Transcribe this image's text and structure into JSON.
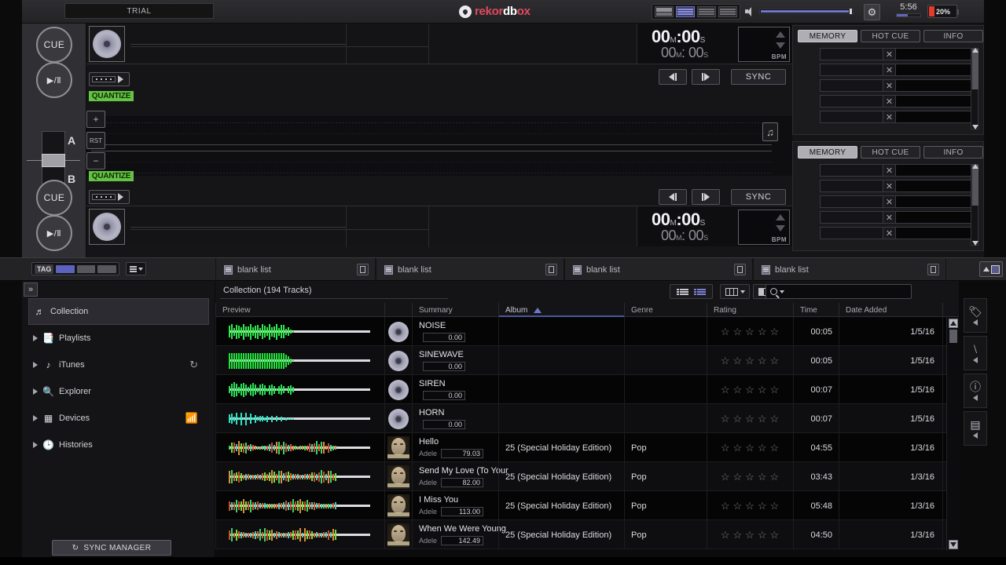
{
  "topbar": {
    "trial_label": "TRIAL",
    "logo": {
      "part1": "rek",
      "part2": "or",
      "part3": "db",
      "part4": "ox"
    },
    "clock_time": "5:56",
    "battery_pct": "20%",
    "gear_icon": "gear-icon",
    "speaker_icon": "speaker-icon"
  },
  "deck_controls": {
    "cue_label": "CUE",
    "play_pause_label": "▶/Ⅱ",
    "crossfader_a": "A",
    "crossfader_b": "B"
  },
  "decks": [
    {
      "id": "deck-a",
      "quantize_label": "QUANTIZE",
      "plus_label": "+",
      "reset_label": "RST",
      "minus_label": "−",
      "time_main_min": "00",
      "time_main_sec": "00",
      "time_sub_min": "00",
      "time_sub_sec": "00",
      "unit_m": "M",
      "unit_s": "S",
      "bpm_label": "BPM",
      "bpm_value": "",
      "sync_label": "SYNC"
    },
    {
      "id": "deck-b",
      "quantize_label": "QUANTIZE",
      "time_main_min": "00",
      "time_main_sec": "00",
      "time_sub_min": "00",
      "time_sub_sec": "00",
      "unit_m": "M",
      "unit_s": "S",
      "bpm_label": "BPM",
      "bpm_value": "",
      "sync_label": "SYNC"
    }
  ],
  "cue_panels": [
    {
      "tabs": [
        {
          "label": "MEMORY",
          "active": true
        },
        {
          "label": "HOT CUE",
          "active": false
        },
        {
          "label": "INFO",
          "active": false
        }
      ],
      "rows": [
        "",
        "",
        "",
        "",
        ""
      ],
      "delete_icon": "✕"
    },
    {
      "tabs": [
        {
          "label": "MEMORY",
          "active": true
        },
        {
          "label": "HOT CUE",
          "active": false
        },
        {
          "label": "INFO",
          "active": false
        }
      ],
      "rows": [
        "",
        "",
        "",
        "",
        ""
      ],
      "delete_icon": "✕"
    }
  ],
  "browser": {
    "tag_label": "TAG",
    "playlist_tabs": [
      {
        "label": "blank list"
      },
      {
        "label": "blank list"
      },
      {
        "label": "blank list"
      },
      {
        "label": "blank list"
      }
    ],
    "sidebar": {
      "items": [
        {
          "label": "Collection",
          "icon": "music-note-icon",
          "selected": true,
          "expandable": false,
          "trailing": ""
        },
        {
          "label": "Playlists",
          "icon": "playlist-icon",
          "selected": false,
          "expandable": true,
          "trailing": ""
        },
        {
          "label": "iTunes",
          "icon": "itunes-icon",
          "selected": false,
          "expandable": true,
          "trailing": "↻"
        },
        {
          "label": "Explorer",
          "icon": "explorer-icon",
          "selected": false,
          "expandable": true,
          "trailing": ""
        },
        {
          "label": "Devices",
          "icon": "usb-icon",
          "selected": false,
          "expandable": true,
          "trailing": "ᴴ"
        },
        {
          "label": "Histories",
          "icon": "history-icon",
          "selected": false,
          "expandable": true,
          "trailing": ""
        }
      ],
      "sync_manager_label": "SYNC MANAGER",
      "sync_icon": "refresh-icon"
    },
    "content_title": "Collection (194 Tracks)",
    "search_placeholder": "",
    "search_value": "",
    "columns": [
      {
        "key": "preview",
        "label": "Preview",
        "sorted": false
      },
      {
        "key": "artwork",
        "label": "",
        "sorted": false
      },
      {
        "key": "summary",
        "label": "Summary",
        "sorted": false
      },
      {
        "key": "album",
        "label": "Album",
        "sorted": true,
        "sort_dir": "asc"
      },
      {
        "key": "genre",
        "label": "Genre",
        "sorted": false
      },
      {
        "key": "rating",
        "label": "Rating",
        "sorted": false
      },
      {
        "key": "time",
        "label": "Time",
        "sorted": false
      },
      {
        "key": "date",
        "label": "Date Added",
        "sorted": false
      }
    ],
    "tracks": [
      {
        "title": "NOISE",
        "artist": "",
        "bpm": "0.00",
        "album": "",
        "genre": "",
        "rating": 0,
        "time": "00:05",
        "date": "1/5/16",
        "art": "disc",
        "wave_color": "#2fe84a",
        "wave_shape": "noise",
        "wave_len": 0.62
      },
      {
        "title": "SINEWAVE",
        "artist": "",
        "bpm": "0.00",
        "album": "",
        "genre": "",
        "rating": 0,
        "time": "00:05",
        "date": "1/5/16",
        "art": "disc",
        "wave_color": "#23e03c",
        "wave_shape": "block",
        "wave_len": 0.66
      },
      {
        "title": "SIREN",
        "artist": "",
        "bpm": "0.00",
        "album": "",
        "genre": "",
        "rating": 0,
        "time": "00:07",
        "date": "1/5/16",
        "art": "disc",
        "wave_color": "#2ae055",
        "wave_shape": "siren",
        "wave_len": 0.62
      },
      {
        "title": "HORN",
        "artist": "",
        "bpm": "0.00",
        "album": "",
        "genre": "",
        "rating": 0,
        "time": "00:07",
        "date": "1/5/16",
        "art": "disc",
        "wave_color": "#2ee0c0",
        "wave_shape": "horn",
        "wave_len": 0.6
      },
      {
        "title": "Hello",
        "artist": "Adele",
        "bpm": "79.03",
        "album": "25 (Special Holiday Edition)",
        "genre": "Pop",
        "rating": 0,
        "time": "04:55",
        "date": "1/3/16",
        "art": "adele",
        "wave_color": "#7ad14a",
        "wave_shape": "music",
        "wave_len": 1.0
      },
      {
        "title": "Send My Love (To Your",
        "artist": "Adele",
        "bpm": "82.00",
        "album": "25 (Special Holiday Edition)",
        "genre": "Pop",
        "rating": 0,
        "time": "03:43",
        "date": "1/3/16",
        "art": "adele",
        "wave_color": "#e0642e",
        "wave_shape": "music2",
        "wave_len": 1.0
      },
      {
        "title": "I Miss You",
        "artist": "Adele",
        "bpm": "113.00",
        "album": "25 (Special Holiday Edition)",
        "genre": "Pop",
        "rating": 0,
        "time": "05:48",
        "date": "1/3/16",
        "art": "adele",
        "wave_color": "#d4562a",
        "wave_shape": "music3",
        "wave_len": 1.0
      },
      {
        "title": "When We Were Young",
        "artist": "Adele",
        "bpm": "142.49",
        "album": "25 (Special Holiday Edition)",
        "genre": "Pop",
        "rating": 0,
        "time": "04:50",
        "date": "1/3/16",
        "art": "adele",
        "wave_color": "#d8632e",
        "wave_shape": "music4",
        "wave_len": 1.0
      }
    ],
    "star_empty": "☆",
    "right_rail": [
      {
        "icon": "tag-icon",
        "glyph": "▰"
      },
      {
        "icon": "related-icon",
        "glyph": "⧉"
      },
      {
        "icon": "info-icon",
        "glyph": "ℹ"
      },
      {
        "icon": "browser-icon",
        "glyph": "▤"
      }
    ]
  },
  "colors": {
    "accent_red": "#e04a5f",
    "quantize_green": "#64c442",
    "sort_blue": "#6b78c8",
    "battery_red": "#e33b2c"
  }
}
